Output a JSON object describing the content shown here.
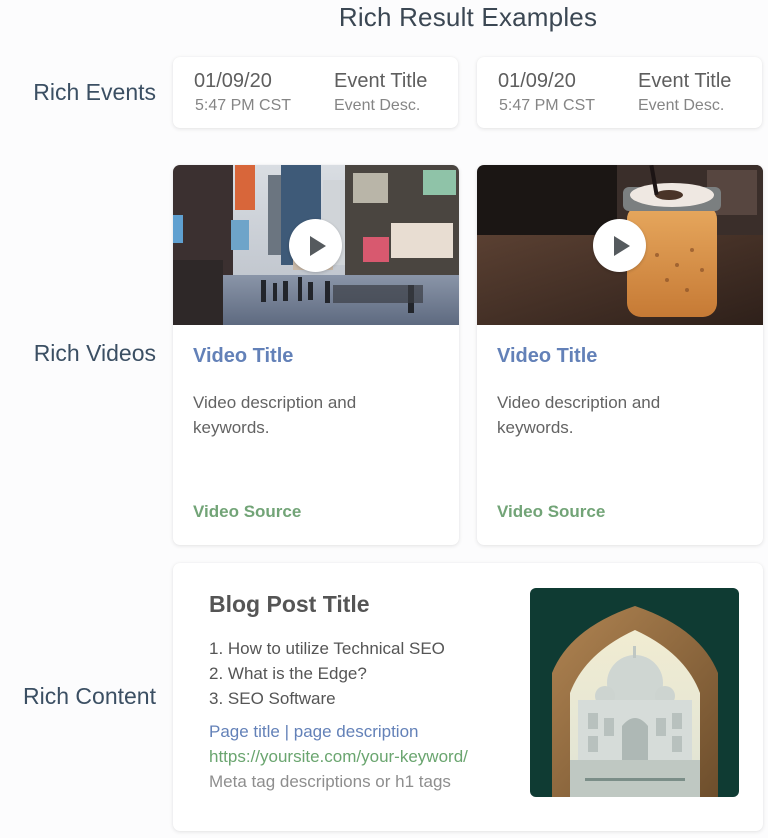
{
  "page": {
    "title": "Rich Result Examples"
  },
  "rows": {
    "events": {
      "label": "Rich Events"
    },
    "videos": {
      "label": "Rich Videos"
    },
    "content": {
      "label": "Rich Content"
    }
  },
  "events": [
    {
      "date": "01/09/20",
      "time": "5:47 PM CST",
      "title": "Event Title",
      "description": "Event Desc."
    },
    {
      "date": "01/09/20",
      "time": "5:47 PM CST",
      "title": "Event Title",
      "description": "Event Desc."
    }
  ],
  "videos": [
    {
      "thumbnail": "city-street-scene",
      "title": "Video Title",
      "description": "Video description and keywords.",
      "source": "Video Source"
    },
    {
      "thumbnail": "iced-coffee-jar",
      "title": "Video Title",
      "description": "Video description and keywords.",
      "source": "Video Source"
    }
  ],
  "content": {
    "title": "Blog Post Title",
    "list": [
      "1. How to utilize Technical SEO",
      "2. What is the Edge?",
      "3. SEO Software"
    ],
    "serp_title": "Page title | page description",
    "serp_url": "https://yoursite.com/your-keyword/",
    "serp_meta": "Meta tag descriptions or h1 tags",
    "image": "taj-mahal-through-arch"
  },
  "colors": {
    "link_blue": "#6381b8",
    "source_green": "#72a477",
    "label_slate": "#3b4f63"
  }
}
